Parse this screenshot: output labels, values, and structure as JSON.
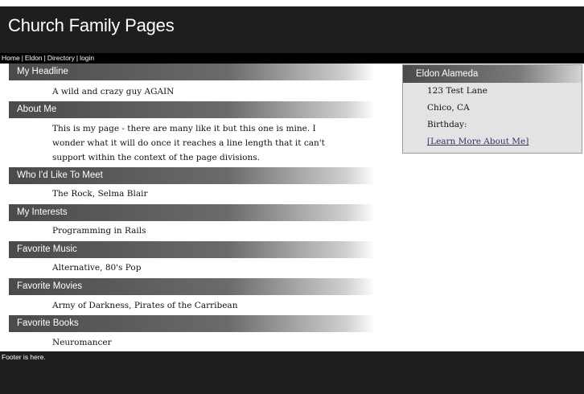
{
  "header": {
    "title": "Church Family Pages"
  },
  "nav": {
    "items": [
      {
        "label": "Home"
      },
      {
        "label": "Eldon"
      },
      {
        "label": "Directory"
      },
      {
        "label": "login"
      }
    ],
    "separator": "|"
  },
  "sections": [
    {
      "heading": "My Headline",
      "body": "A wild and crazy guy AGAIN"
    },
    {
      "heading": "About Me",
      "body": "This is my page - there are many like it but this one is mine. I wonder what it will do once it reaches a line length that it can't support within the context of the page divisions."
    },
    {
      "heading": "Who I'd Like To Meet",
      "body": "The Rock, Selma Blair"
    },
    {
      "heading": "My Interests",
      "body": "Programming in Rails"
    },
    {
      "heading": "Favorite Music",
      "body": "Alternative, 80's Pop"
    },
    {
      "heading": "Favorite Movies",
      "body": "Army of Darkness, Pirates of the Carribean"
    },
    {
      "heading": "Favorite Books",
      "body": "Neuromancer"
    }
  ],
  "sidebar": {
    "name": "Eldon Alameda",
    "address": "123 Test Lane",
    "city": "Chico, CA",
    "birthday_label": "Birthday:",
    "learn_more": "[Learn More About Me]"
  },
  "footer": {
    "text": "Footer is here."
  },
  "colors": {
    "header_bg": "#1e1e1e",
    "section_gradient_start": "#4a4a4a",
    "sidebar_bg": "#e3e3e3"
  }
}
